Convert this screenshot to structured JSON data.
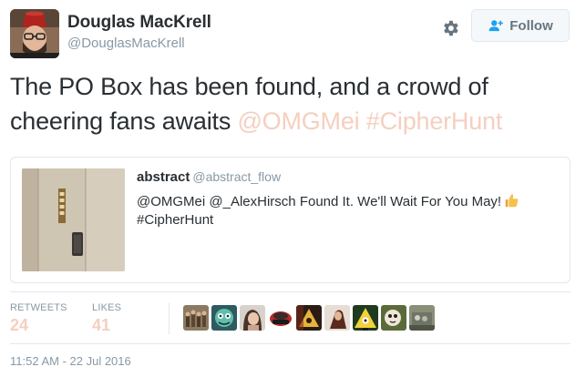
{
  "author": {
    "display_name": "Douglas MacKrell",
    "screen_name": "@DouglasMacKrell",
    "avatar_icon": "user-avatar"
  },
  "actions": {
    "settings_icon": "gear-icon",
    "follow_label": "Follow",
    "follow_icon": "add-user-icon"
  },
  "tweet": {
    "text_plain": "The PO Box has been found, and a crowd of cheering fans awaits ",
    "mention": "@OMGMei",
    "hashtag": "#CipherHunt"
  },
  "quote": {
    "name": "abstract",
    "handle": "@abstract_flow",
    "text_line1": "@OMGMei @_AlexHirsch Found It. We'll Wait For You May!",
    "text_line2": "#CipherHunt",
    "media_icon": "po-box-photo"
  },
  "stats": {
    "retweets_label": "RETWEETS",
    "retweets_value": "24",
    "likes_label": "LIKES",
    "likes_value": "41"
  },
  "timestamp": "11:52 AM - 22 Jul 2016",
  "colors": {
    "link": "#f5cfc0",
    "text": "#292f33",
    "muted": "#8899a6",
    "border": "#e1e8ed"
  }
}
